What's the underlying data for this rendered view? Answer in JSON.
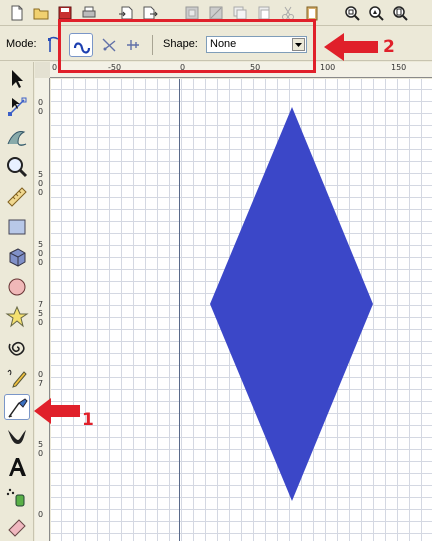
{
  "toolbar": {
    "commands": [
      "new-icon",
      "open-icon",
      "save-icon",
      "print-icon",
      "import-icon",
      "export-icon",
      "undo-icon",
      "redo-icon",
      "copy-icon",
      "cut-icon",
      "paste-icon",
      "zoom-selection-icon",
      "zoom-drawing-icon",
      "zoom-page-icon"
    ]
  },
  "tool_controls": {
    "mode_label": "Mode:",
    "modes": [
      "regular-bezier-icon",
      "spiro-path-icon",
      "bspline-path-icon",
      "paraxial-path-icon"
    ],
    "active_mode": "spiro-path-icon",
    "shape_label": "Shape:",
    "shape_value": "None"
  },
  "toolbox": {
    "tools": [
      "selector-icon",
      "node-editor-icon",
      "tweak-icon",
      "zoom-icon",
      "measure-icon",
      "rectangle-icon",
      "3d-box-icon",
      "ellipse-icon",
      "star-icon",
      "spiral-icon",
      "pencil-icon",
      "pen-icon",
      "calligraphy-icon",
      "text-icon",
      "spray-icon",
      "eraser-icon"
    ],
    "active_tool": "pen-icon"
  },
  "rulers": {
    "horizontal": [
      "0",
      "-50",
      "0",
      "50",
      "100",
      "150"
    ],
    "vertical": [
      "0",
      "0",
      "5",
      "0",
      "0",
      "5",
      "0",
      "0",
      "7",
      "5",
      "0",
      "0",
      "7",
      "5",
      "0",
      "0"
    ]
  },
  "drawing": {
    "shape_fill": "#3b47c8"
  },
  "annotations": {
    "label_1": "1",
    "label_2": "2",
    "color": "#e0202a"
  }
}
